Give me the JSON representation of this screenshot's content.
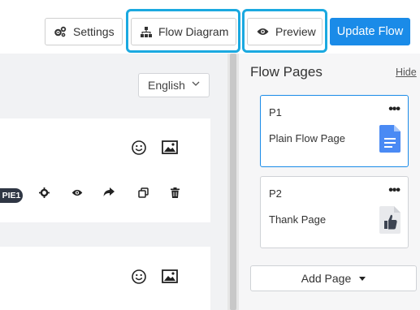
{
  "toolbar": {
    "settings_label": "Settings",
    "flow_diagram_label": "Flow Diagram",
    "preview_label": "Preview",
    "update_flow_label": "Update Flow"
  },
  "editor": {
    "language": "English",
    "pie_badge": "PIE1"
  },
  "flow_pages": {
    "title": "Flow Pages",
    "hide_label": "Hide",
    "pages": [
      {
        "id": "P1",
        "name": "Plain Flow Page",
        "icon": "document-icon",
        "active": true
      },
      {
        "id": "P2",
        "name": "Thank Page",
        "icon": "thumbs-up-icon",
        "active": false
      }
    ],
    "add_page_label": "Add Page"
  },
  "colors": {
    "accent": "#1a8be8",
    "highlight": "#1ba9e0",
    "doc_icon": "#4a8af4"
  }
}
